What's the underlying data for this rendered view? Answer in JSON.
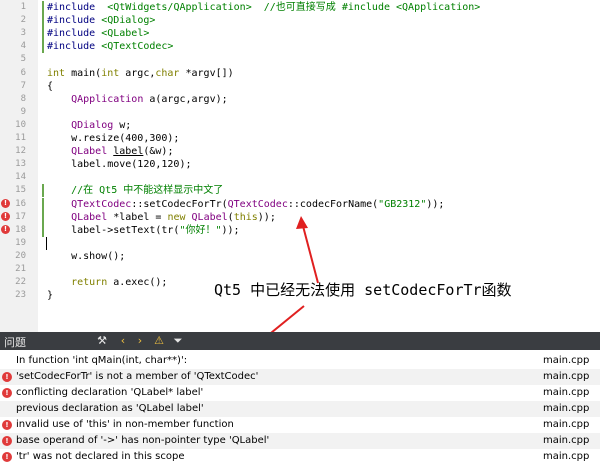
{
  "editor": {
    "lines": [
      {
        "n": "1",
        "mark": true,
        "err": false,
        "spans": [
          [
            "pre",
            "#include"
          ],
          [
            "",
            "  "
          ],
          [
            "str",
            "<QtWidgets/QApplication>"
          ],
          [
            "",
            "  "
          ],
          [
            "cmt",
            "//也可直接写成 #include <QApplication>"
          ]
        ]
      },
      {
        "n": "2",
        "mark": true,
        "err": false,
        "spans": [
          [
            "pre",
            "#include"
          ],
          [
            "",
            " "
          ],
          [
            "str",
            "<QDialog>"
          ]
        ]
      },
      {
        "n": "3",
        "mark": true,
        "err": false,
        "spans": [
          [
            "pre",
            "#include"
          ],
          [
            "",
            " "
          ],
          [
            "str",
            "<QLabel>"
          ]
        ]
      },
      {
        "n": "4",
        "mark": true,
        "err": false,
        "spans": [
          [
            "pre",
            "#include"
          ],
          [
            "",
            " "
          ],
          [
            "str",
            "<QTextCodec>"
          ]
        ]
      },
      {
        "n": "5",
        "mark": false,
        "err": false,
        "spans": []
      },
      {
        "n": "6",
        "mark": false,
        "err": false,
        "spans": [
          [
            "kw",
            "int"
          ],
          [
            "",
            " main("
          ],
          [
            "kw",
            "int"
          ],
          [
            "",
            " argc,"
          ],
          [
            "kw",
            "char"
          ],
          [
            "",
            " *argv[])"
          ]
        ]
      },
      {
        "n": "7",
        "mark": false,
        "err": false,
        "spans": [
          [
            "",
            "{"
          ]
        ]
      },
      {
        "n": "8",
        "mark": false,
        "err": false,
        "spans": [
          [
            "",
            "    "
          ],
          [
            "cls",
            "QApplication"
          ],
          [
            "",
            " a(argc,argv);"
          ]
        ]
      },
      {
        "n": "9",
        "mark": false,
        "err": false,
        "spans": []
      },
      {
        "n": "10",
        "mark": false,
        "err": false,
        "spans": [
          [
            "",
            "    "
          ],
          [
            "cls",
            "QDialog"
          ],
          [
            "",
            " w;"
          ]
        ]
      },
      {
        "n": "11",
        "mark": false,
        "err": false,
        "spans": [
          [
            "",
            "    w.resize(400,300);"
          ]
        ]
      },
      {
        "n": "12",
        "mark": false,
        "err": false,
        "spans": [
          [
            "",
            "    "
          ],
          [
            "cls",
            "QLabel"
          ],
          [
            "",
            " "
          ],
          [
            "u",
            "label"
          ],
          [
            "",
            "(&w);"
          ]
        ]
      },
      {
        "n": "13",
        "mark": false,
        "err": false,
        "spans": [
          [
            "",
            "    label.move(120,120);"
          ]
        ]
      },
      {
        "n": "14",
        "mark": false,
        "err": false,
        "spans": []
      },
      {
        "n": "15",
        "mark": true,
        "err": false,
        "spans": [
          [
            "",
            "    "
          ],
          [
            "cmt",
            "//在 Qt5 中不能这样显示中文了"
          ]
        ]
      },
      {
        "n": "16",
        "mark": true,
        "err": true,
        "spans": [
          [
            "",
            "    "
          ],
          [
            "cls",
            "QTextCodec"
          ],
          [
            "",
            "::setCodecForTr("
          ],
          [
            "cls",
            "QTextCodec"
          ],
          [
            "",
            "::codecForName("
          ],
          [
            "str",
            "\"GB2312\""
          ],
          [
            "",
            "));"
          ]
        ]
      },
      {
        "n": "17",
        "mark": true,
        "err": true,
        "spans": [
          [
            "",
            "    "
          ],
          [
            "cls",
            "QLabel"
          ],
          [
            "",
            " *label = "
          ],
          [
            "kw",
            "new"
          ],
          [
            "",
            " "
          ],
          [
            "cls",
            "QLabel"
          ],
          [
            "",
            "("
          ],
          [
            "kw",
            "this"
          ],
          [
            "",
            "));"
          ]
        ]
      },
      {
        "n": "18",
        "mark": true,
        "err": true,
        "spans": [
          [
            "",
            "    label->setText(tr("
          ],
          [
            "str",
            "\"你好！\""
          ],
          [
            "",
            "));"
          ]
        ]
      },
      {
        "n": "19",
        "mark": false,
        "err": false,
        "cursor": true,
        "spans": []
      },
      {
        "n": "20",
        "mark": false,
        "err": false,
        "spans": [
          [
            "",
            "    w.show();"
          ]
        ]
      },
      {
        "n": "21",
        "mark": false,
        "err": false,
        "spans": []
      },
      {
        "n": "22",
        "mark": false,
        "err": false,
        "spans": [
          [
            "",
            "    "
          ],
          [
            "kw",
            "return"
          ],
          [
            "",
            " a.exec();"
          ]
        ]
      },
      {
        "n": "23",
        "mark": false,
        "err": false,
        "spans": [
          [
            "",
            "}"
          ]
        ]
      }
    ]
  },
  "annotation": "Qt5 中已经无法使用 setCodecForTr函数",
  "issues_panel": {
    "title": "问题",
    "toolbar_icons": [
      "build-icon",
      "prev-icon",
      "next-icon",
      "warning-filter-icon",
      "filter-icon"
    ],
    "items": [
      {
        "icon": false,
        "message": "In function 'int qMain(int, char**)':",
        "file": "main.cpp"
      },
      {
        "icon": true,
        "message": "'setCodecForTr' is not a member of 'QTextCodec'",
        "file": "main.cpp"
      },
      {
        "icon": true,
        "message": "conflicting declaration 'QLabel* label'",
        "file": "main.cpp"
      },
      {
        "icon": false,
        "message": "previous declaration as 'QLabel label'",
        "file": "main.cpp"
      },
      {
        "icon": true,
        "message": "invalid use of 'this' in non-member function",
        "file": "main.cpp"
      },
      {
        "icon": true,
        "message": "base operand of '->' has non-pointer type 'QLabel'",
        "file": "main.cpp"
      },
      {
        "icon": true,
        "message": "'tr' was not declared in this scope",
        "file": "main.cpp"
      }
    ]
  },
  "colors": {
    "error": "#e03a3a",
    "arrow": "#e02020",
    "change_mark": "#6aa84f"
  }
}
